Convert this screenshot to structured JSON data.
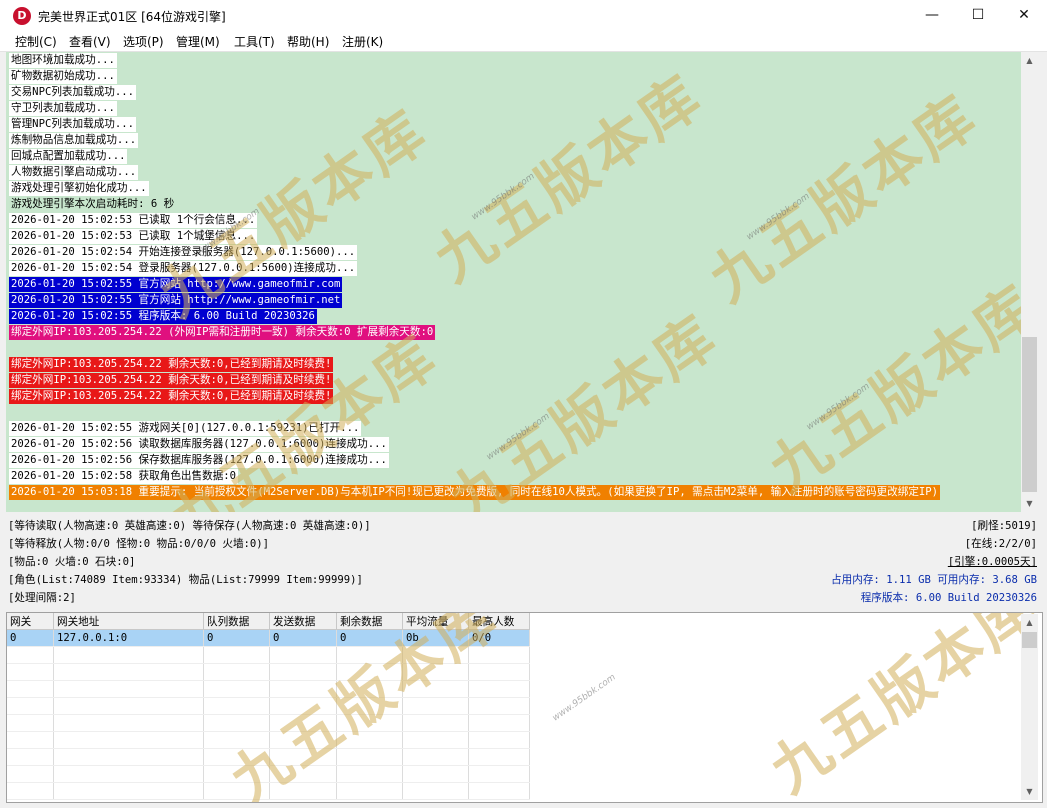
{
  "window": {
    "title": "完美世界正式01区 [64位游戏引擎]",
    "icon_letter": "D",
    "buttons": {
      "minimize": "—",
      "maximize": "☐",
      "close": "✕"
    }
  },
  "menu": [
    "控制(C)",
    "查看(V)",
    "选项(P)",
    "管理(M)",
    "工具(T)",
    "帮助(H)",
    "注册(K)"
  ],
  "log": [
    {
      "text": "地图环境加载成功...",
      "style": "white"
    },
    {
      "text": "矿物数据初始成功...",
      "style": "white"
    },
    {
      "text": "交易NPC列表加载成功...",
      "style": "white"
    },
    {
      "text": "守卫列表加载成功...",
      "style": "white"
    },
    {
      "text": "管理NPC列表加载成功...",
      "style": "white"
    },
    {
      "text": "炼制物品信息加载成功...",
      "style": "white"
    },
    {
      "text": "回城点配置加载成功...",
      "style": "white"
    },
    {
      "text": "人物数据引擎启动成功...",
      "style": "white"
    },
    {
      "text": "游戏处理引擎初始化成功...",
      "style": "white"
    },
    {
      "text": "游戏处理引擎本次启动耗时: 6 秒",
      "style": "plain"
    },
    {
      "text": "2026-01-20 15:02:53 已读取 1个行会信息...",
      "style": "white"
    },
    {
      "text": "2026-01-20 15:02:53 已读取 1个城堡信息...",
      "style": "white"
    },
    {
      "text": "2026-01-20 15:02:54 开始连接登录服务器(127.0.0.1:5600)...",
      "style": "white"
    },
    {
      "text": "2026-01-20 15:02:54 登录服务器(127.0.0.1:5600)连接成功...",
      "style": "white"
    },
    {
      "text": "2026-01-20 15:02:55 官方网站 http://www.gameofmir.com",
      "style": "blue"
    },
    {
      "text": "2026-01-20 15:02:55 官方网站 http://www.gameofmir.net",
      "style": "blue"
    },
    {
      "text": "2026-01-20 15:02:55 程序版本: 6.00 Build 20230326",
      "style": "blue"
    },
    {
      "text": "绑定外网IP:103.205.254.22 (外网IP需和注册时一致) 剩余天数:0 扩展剩余天数:0",
      "style": "pink"
    },
    {
      "text": "",
      "style": "none"
    },
    {
      "text": "绑定外网IP:103.205.254.22 剩余天数:0,已经到期请及时续费!",
      "style": "red"
    },
    {
      "text": "绑定外网IP:103.205.254.22 剩余天数:0,已经到期请及时续费!",
      "style": "red"
    },
    {
      "text": "绑定外网IP:103.205.254.22 剩余天数:0,已经到期请及时续费!",
      "style": "red"
    },
    {
      "text": "",
      "style": "none"
    },
    {
      "text": "2026-01-20 15:02:55 游戏网关[0](127.0.0.1:59231)已打开...",
      "style": "white"
    },
    {
      "text": "2026-01-20 15:02:56 读取数据库服务器(127.0.0.1:6000)连接成功...",
      "style": "white"
    },
    {
      "text": "2026-01-20 15:02:56 保存数据库服务器(127.0.0.1:6000)连接成功...",
      "style": "white"
    },
    {
      "text": "2026-01-20 15:02:58 获取角色出售数据:0",
      "style": "white"
    },
    {
      "text": "2026-01-20 15:03:18 重要提示: 当前授权文件(M2Server.DB)与本机IP不同!现已更改为免费版, 同时在线10人模式。(如果更换了IP, 需点击M2菜单, 输入注册时的账号密码更改绑定IP)",
      "style": "orange"
    }
  ],
  "status": {
    "left": [
      "[等待读取(人物高速:0 英雄高速:0) 等待保存(人物高速:0 英雄高速:0)]",
      "[等待释放(人物:0/0 怪物:0 物品:0/0/0 火墙:0)]",
      "[物品:0 火墙:0 石块:0]",
      "[角色(List:74089 Item:93334) 物品(List:79999 Item:99999)]",
      "[处理间隔:2]"
    ],
    "right": [
      {
        "text": "[刷怪:5019]",
        "color": "#000000"
      },
      {
        "text": "[在线:2/2/0]",
        "color": "#000000"
      },
      {
        "text": "[引擎:0.0005天]",
        "color": "#000000"
      },
      {
        "text": "占用内存: 1.11 GB 可用内存: 3.68 GB",
        "color": "#0a2dac"
      },
      {
        "text": "程序版本: 6.00 Build 20230326",
        "color": "#0a2dac"
      }
    ]
  },
  "gateway_table": {
    "columns": [
      "网关",
      "网关地址",
      "队列数据",
      "发送数据",
      "剩余数据",
      "平均流量",
      "最高人数"
    ],
    "rows": [
      [
        "0",
        "127.0.0.1:0",
        "0",
        "0",
        "0",
        "0b",
        "0/0"
      ]
    ]
  },
  "watermark": {
    "text": "九五版本库",
    "url": "www.95bbk.com",
    "color": "#d2af5a"
  },
  "icons": {
    "scroll_up": "scroll-up-arrow-icon",
    "scroll_down": "scroll-down-arrow-icon"
  }
}
